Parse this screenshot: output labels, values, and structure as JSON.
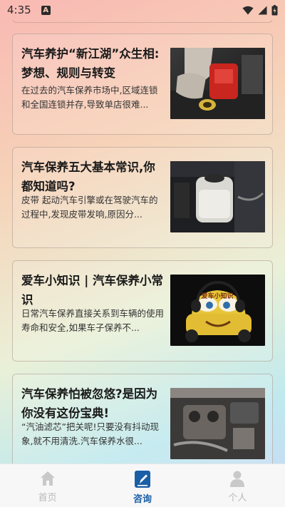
{
  "status_bar": {
    "time": "4:35",
    "notification_letter": "A",
    "icons": [
      "wifi-icon",
      "signal-icon",
      "battery-icon"
    ]
  },
  "articles": [
    {
      "title": "汽车养护“新江湖”众生相:梦想、规则与转变",
      "summary": "在过去的汽车保养市场中,区域连锁和全国连锁并存,导致单店很难...",
      "thumbnail": "engine-oil-photo"
    },
    {
      "title": "汽车保养五大基本常识,你都知道吗?",
      "summary": "皮带 起动汽车引擎或在驾驶汽车的过程中,发现皮带发响,原因分...",
      "thumbnail": "coolant-reservoir-photo"
    },
    {
      "title": "爱车小知识 | 汽车保养小常识",
      "summary": "日常汽车保养直接关系到车辆的使用寿命和安全,如果车子保养不...",
      "thumbnail": "cartoon-car-photo",
      "thumbnail_caption": "爱车小知识"
    },
    {
      "title": "汽车保养怕被忽悠?是因为你没有这份宝典!",
      "summary": "“汽油滤芯”把关呢!只要没有抖动现象,就不用清洗.汽车保养水很...",
      "thumbnail": "engine-bay-photo"
    }
  ],
  "tabbar": {
    "tabs": [
      {
        "label": "首页",
        "icon": "home-icon",
        "active": false
      },
      {
        "label": "咨询",
        "icon": "edit-document-icon",
        "active": true
      },
      {
        "label": "个人",
        "icon": "person-icon",
        "active": false
      }
    ],
    "active_color": "#1a5fa6",
    "inactive_color": "#b9b9b9"
  }
}
